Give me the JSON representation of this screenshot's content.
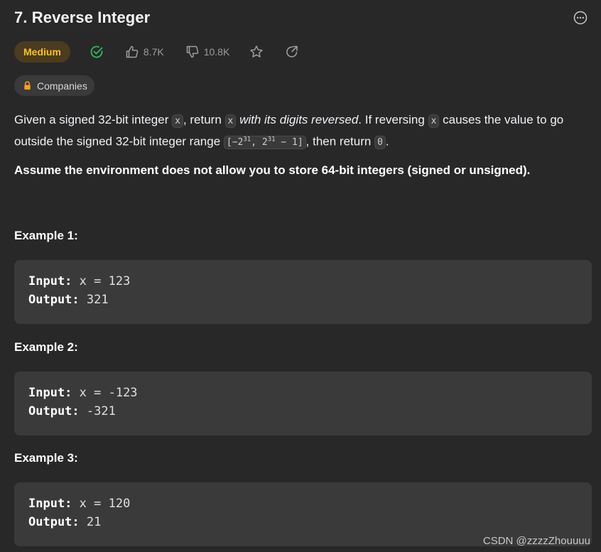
{
  "problem": {
    "title": "7. Reverse Integer",
    "difficulty": "Medium",
    "likes": "8.7K",
    "dislikes": "10.8K",
    "companies_label": "Companies"
  },
  "description": {
    "p1_a": "Given a signed 32-bit integer ",
    "code_x": "x",
    "p1_b": ", return ",
    "p1_em": " with its digits reversed",
    "p1_c": ". If reversing ",
    "p1_d": " causes the value to go outside the signed 32-bit integer range ",
    "range_open": "[−2",
    "range_exp1": "31",
    "range_mid": ", 2",
    "range_exp2": "31",
    "range_close": " − 1]",
    "p1_e": ", then return ",
    "code_zero": "0",
    "p1_f": ".",
    "assume": "Assume the environment does not allow you to store 64-bit integers (signed or unsigned)."
  },
  "examples": [
    {
      "title": "Example 1:",
      "input_label": "Input:",
      "input_value": " x = 123",
      "output_label": "Output:",
      "output_value": " 321"
    },
    {
      "title": "Example 2:",
      "input_label": "Input:",
      "input_value": " x = -123",
      "output_label": "Output:",
      "output_value": " -321"
    },
    {
      "title": "Example 3:",
      "input_label": "Input:",
      "input_value": " x = 120",
      "output_label": "Output:",
      "output_value": " 21"
    }
  ],
  "watermark": "CSDN @zzzzZhouuuu",
  "colors": {
    "background": "#282828",
    "medium": "#ffc01e",
    "solved": "#2cbb5d",
    "code_bg": "#3a3a3a"
  },
  "icons": [
    "more-icon",
    "solved-check-icon",
    "thumbs-up-icon",
    "thumbs-down-icon",
    "star-icon",
    "share-icon",
    "lock-icon"
  ]
}
